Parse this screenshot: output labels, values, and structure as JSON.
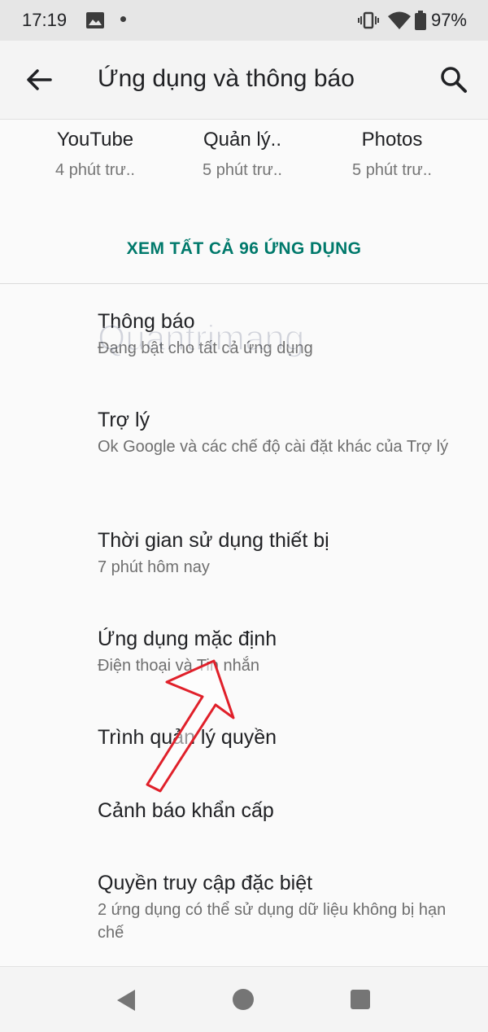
{
  "status_bar": {
    "time": "17:19",
    "battery": "97%"
  },
  "app_bar": {
    "title": "Ứng dụng và thông báo"
  },
  "recent_apps": [
    {
      "name": "YouTube",
      "time": "4 phút trư.."
    },
    {
      "name": "Quản lý..",
      "time": "5 phút trư.."
    },
    {
      "name": "Photos",
      "time": "5 phút trư.."
    }
  ],
  "see_all": "XEM TẤT CẢ 96 ỨNG DỤNG",
  "menu": [
    {
      "title": "Thông báo",
      "subtitle": "Đang bật cho tất cả ứng dụng"
    },
    {
      "title": "Trợ lý",
      "subtitle": "Ok Google và các chế độ cài đặt khác của Trợ lý"
    },
    {
      "title": "Thời gian sử dụng thiết bị",
      "subtitle": "7 phút hôm nay"
    },
    {
      "title": "Ứng dụng mặc định",
      "subtitle": "Điện thoại và Tin nhắn"
    },
    {
      "title": "Trình quản lý quyền",
      "subtitle": ""
    },
    {
      "title": "Cảnh báo khẩn cấp",
      "subtitle": ""
    },
    {
      "title": "Quyền truy cập đặc biệt",
      "subtitle": "2 ứng dụng có thể sử dụng dữ liệu không bị hạn chế"
    }
  ],
  "watermark": "Quantrimang",
  "colors": {
    "accent": "#00796b",
    "annotation_arrow": "#e0202a"
  },
  "icons": {
    "status": [
      "gallery-icon",
      "dot-icon",
      "vibrate-icon",
      "wifi-icon",
      "battery-icon"
    ],
    "app_bar": [
      "back-arrow-icon",
      "search-icon"
    ],
    "nav": [
      "nav-back-icon",
      "nav-home-icon",
      "nav-recents-icon"
    ]
  }
}
